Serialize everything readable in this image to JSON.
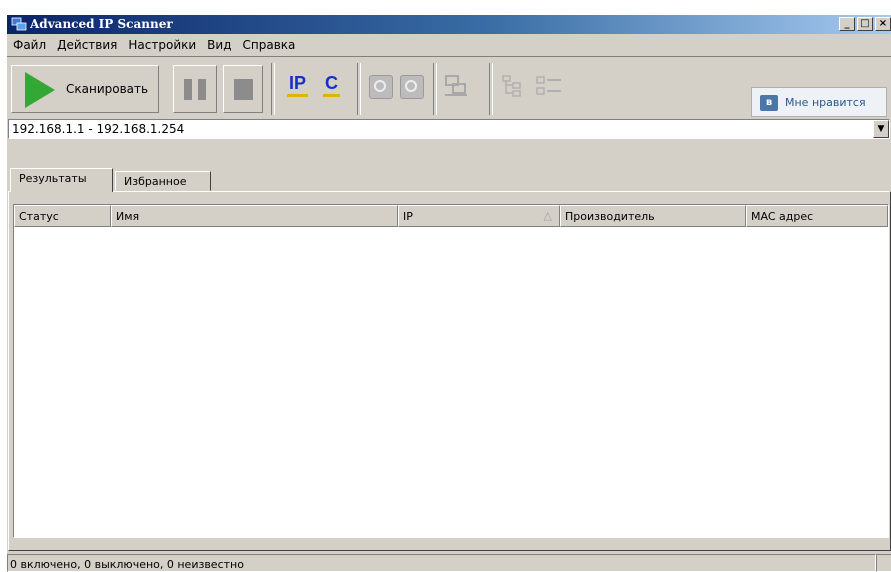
{
  "window": {
    "title": "Advanced IP Scanner",
    "controls": {
      "minimize": "_",
      "maximize": "□",
      "close": "×"
    }
  },
  "menu": [
    {
      "label": "Файл"
    },
    {
      "label": "Действия"
    },
    {
      "label": "Настройки"
    },
    {
      "label": "Вид"
    },
    {
      "label": "Справка"
    }
  ],
  "toolbar": {
    "scan_label": "Сканировать",
    "ip_label": "IP",
    "c_label": "C",
    "like_badge": "в",
    "like_label": "Мне нравится"
  },
  "address": {
    "value": "192.168.1.1 - 192.168.1.254"
  },
  "tabs": [
    {
      "label": "Результаты"
    },
    {
      "label": "Избранное"
    }
  ],
  "table": {
    "columns": [
      "Статус",
      "Имя",
      "IP",
      "Производитель",
      "MAC адрес"
    ],
    "rows": []
  },
  "status": {
    "text": "0 включено, 0 выключено, 0 неизвестно"
  },
  "colors": {
    "title_start": "#0a246a",
    "title_end": "#a6caf0",
    "scan_green": "#34a834",
    "icon_blue": "#1530c8",
    "vk_blue": "#4a76a8"
  }
}
